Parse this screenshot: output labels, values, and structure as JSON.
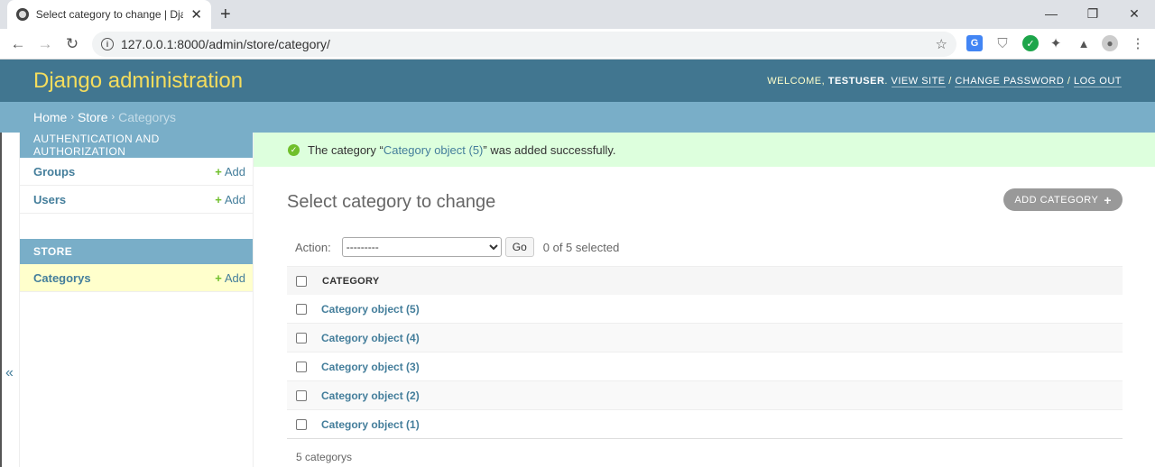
{
  "browser": {
    "tab_title": "Select category to change | Django",
    "url_host": "127.0.0.1",
    "url_rest": ":8000/admin/store/category/"
  },
  "header": {
    "brand": "Django administration",
    "welcome": "WELCOME, ",
    "username": "TESTUSER",
    "view_site": "VIEW SITE",
    "change_password": "CHANGE PASSWORD",
    "log_out": "LOG OUT"
  },
  "breadcrumbs": {
    "home": "Home",
    "store": "Store",
    "current": "Categorys",
    "sep": "›"
  },
  "sidebar": {
    "modules": [
      {
        "caption": "Authentication and Authorization",
        "rows": [
          {
            "name": "Groups",
            "add": "Add"
          },
          {
            "name": "Users",
            "add": "Add"
          }
        ]
      },
      {
        "caption": "Store",
        "rows": [
          {
            "name": "Categorys",
            "add": "Add"
          }
        ]
      }
    ],
    "collapse_glyph": "«"
  },
  "message": {
    "prefix": "The category “",
    "object_link": "Category object (5)",
    "suffix": "” was added successfully."
  },
  "main": {
    "title": "Select category to change",
    "add_button": "ADD CATEGORY",
    "action_label": "Action:",
    "action_selected": "---------",
    "go_label": "Go",
    "selection_count": "0 of 5 selected",
    "column_header": "CATEGORY",
    "rows": [
      "Category object (5)",
      "Category object (4)",
      "Category object (3)",
      "Category object (2)",
      "Category object (1)"
    ],
    "paginator": "5 categorys"
  },
  "colors": {
    "header_bg": "#417690",
    "brand": "#f5dd5d",
    "breadcrumb_bg": "#79aec8",
    "link": "#447e9b",
    "success_bg": "#dfd",
    "add_icon": "#70bf2b"
  }
}
